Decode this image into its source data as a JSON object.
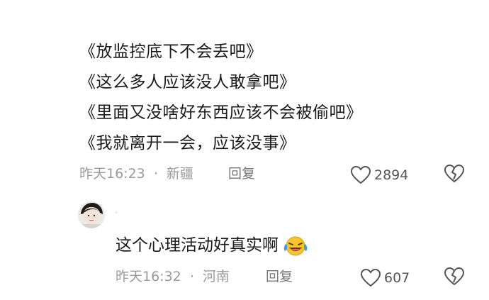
{
  "comment1": {
    "lines": [
      "《放监控底下不会丢吧》",
      "《这么多人应该没人敢拿吧》",
      "《里面又没啥好东西应该不会被偷吧》",
      "《我就离开一会，应该没事》"
    ],
    "time": "昨天16:23",
    "separator": "·",
    "location": "新疆",
    "reply_label": "回复",
    "likes": "2894"
  },
  "comment2": {
    "text": "这个心理活动好真实啊",
    "emoji": "laughing-with-tears-icon",
    "time": "昨天16:32",
    "separator": "·",
    "location": "河南",
    "reply_label": "回复",
    "likes": "607"
  },
  "colors": {
    "text": "#1a1a1a",
    "meta": "#9a9a9a",
    "icon": "#555555",
    "emoji_face": "#f7c52b",
    "emoji_tear": "#3a9bf0"
  }
}
